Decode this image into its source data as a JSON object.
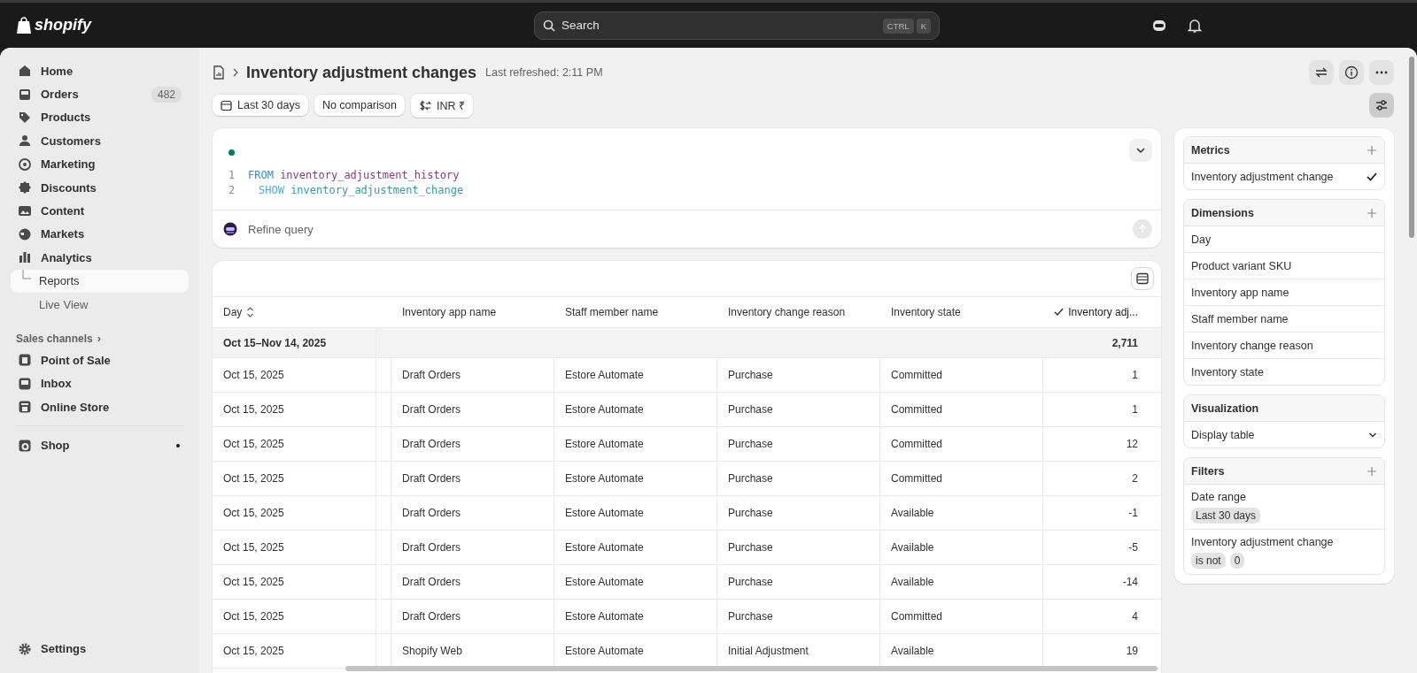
{
  "topbar": {
    "logo": "shopify",
    "search": {
      "placeholder": "Search",
      "keys": [
        "CTRL",
        "K"
      ]
    }
  },
  "sidebar": {
    "items": [
      {
        "label": "Home",
        "selected": false
      },
      {
        "label": "Orders",
        "badge": "482",
        "selected": false
      },
      {
        "label": "Products",
        "selected": false
      },
      {
        "label": "Customers",
        "selected": false
      },
      {
        "label": "Marketing",
        "selected": false
      },
      {
        "label": "Discounts",
        "selected": false
      },
      {
        "label": "Content",
        "selected": false
      },
      {
        "label": "Markets",
        "selected": false
      },
      {
        "label": "Analytics",
        "selected": false,
        "children": [
          {
            "label": "Reports",
            "selected": true
          },
          {
            "label": "Live View",
            "selected": false
          }
        ]
      }
    ],
    "sales_channels": {
      "label": "Sales channels",
      "chevron": "›",
      "items": [
        {
          "label": "Point of Sale"
        },
        {
          "label": "Inbox"
        },
        {
          "label": "Online Store"
        }
      ]
    },
    "apps": [
      {
        "label": "Shop",
        "dot": true
      }
    ],
    "settings": "Settings"
  },
  "header": {
    "title": "Inventory adjustment changes",
    "refreshed": "Last refreshed: 2:11 PM",
    "filters": [
      {
        "kind": "date",
        "label": "Last 30 days"
      },
      {
        "kind": "plain",
        "label": "No comparison"
      },
      {
        "kind": "currency",
        "label": "INR ₹"
      }
    ]
  },
  "query": {
    "lines": [
      {
        "number": "1",
        "keyword": "FROM",
        "text": "inventory_adjustment_history",
        "children": [
          {
            "number": "2",
            "keyword": "SHOW",
            "text": "inventory_adjustment_change"
          }
        ]
      }
    ],
    "placeholder": "Refine query"
  },
  "table": {
    "columns": [
      {
        "label": "Day",
        "sortable": true,
        "checked": false
      },
      {
        "label": "Inventory app name",
        "sortable": false,
        "checked": false
      },
      {
        "label": "Staff member name",
        "sortable": false,
        "checked": false
      },
      {
        "label": "Inventory change reason",
        "sortable": false,
        "checked": false
      },
      {
        "label": "Inventory state",
        "sortable": false,
        "checked": false
      },
      {
        "label": "Inventory adj...",
        "sortable": false,
        "checked": true
      }
    ],
    "summary": {
      "label": "Oct 15–Nov 14, 2025",
      "total": "2,711"
    },
    "rows": [
      [
        "Oct 15, 2025",
        "Draft Orders",
        "Estore Automate",
        "Purchase",
        "Committed",
        "1"
      ],
      [
        "Oct 15, 2025",
        "Draft Orders",
        "Estore Automate",
        "Purchase",
        "Committed",
        "1"
      ],
      [
        "Oct 15, 2025",
        "Draft Orders",
        "Estore Automate",
        "Purchase",
        "Committed",
        "12"
      ],
      [
        "Oct 15, 2025",
        "Draft Orders",
        "Estore Automate",
        "Purchase",
        "Committed",
        "2"
      ],
      [
        "Oct 15, 2025",
        "Draft Orders",
        "Estore Automate",
        "Purchase",
        "Available",
        "-1"
      ],
      [
        "Oct 15, 2025",
        "Draft Orders",
        "Estore Automate",
        "Purchase",
        "Available",
        "-5"
      ],
      [
        "Oct 15, 2025",
        "Draft Orders",
        "Estore Automate",
        "Purchase",
        "Available",
        "-14"
      ],
      [
        "Oct 15, 2025",
        "Draft Orders",
        "Estore Automate",
        "Purchase",
        "Committed",
        "4"
      ],
      [
        "Oct 15, 2025",
        "Shopify Web",
        "Estore Automate",
        "Initial Adjustment",
        "Available",
        "19"
      ]
    ]
  },
  "panel": {
    "metrics": {
      "title": "Metrics",
      "items": [
        {
          "label": "Inventory adjustment change",
          "checked": true
        }
      ]
    },
    "dimensions": {
      "title": "Dimensions",
      "items": [
        "Day",
        "Product variant SKU",
        "Inventory app name",
        "Staff member name",
        "Inventory change reason",
        "Inventory state"
      ]
    },
    "visualization": {
      "title": "Visualization",
      "value": "Display table"
    },
    "filters": {
      "title": "Filters",
      "items": [
        {
          "label": "Date range",
          "chips": [
            "Last 30 days"
          ]
        },
        {
          "label": "Inventory adjustment change",
          "chips": [
            "is not",
            "0"
          ]
        }
      ]
    }
  }
}
